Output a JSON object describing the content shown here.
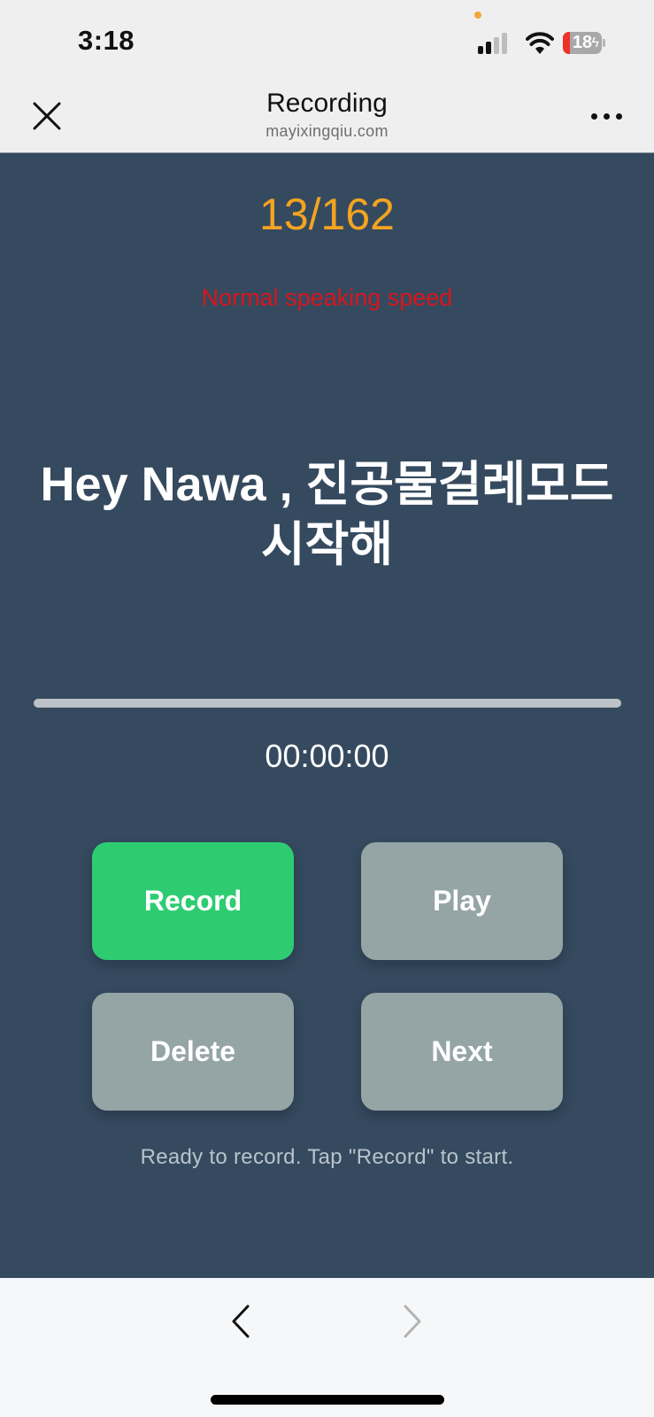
{
  "status_bar": {
    "time": "3:18",
    "battery_percent": "18",
    "battery_level": 0.18,
    "charging": true,
    "signal_bars_active": 2,
    "signal_bars_total": 4,
    "colors": {
      "mic_indicator": "#f4a43a",
      "battery_low": "#f0302a"
    }
  },
  "nav": {
    "title": "Recording",
    "subtitle": "mayixingqiu.com",
    "close_icon": "close-icon",
    "more_icon": "more-horizontal-icon"
  },
  "main": {
    "counter": "13/162",
    "current_index": 13,
    "total": 162,
    "speed_hint": "Normal speaking speed",
    "prompt_text": "Hey Nawa , 진공물걸레모드 시작해",
    "progress": 0,
    "timer": "00:00:00",
    "buttons": {
      "record": "Record",
      "play": "Play",
      "delete": "Delete",
      "next": "Next"
    },
    "status_message": "Ready to record. Tap \"Record\" to start.",
    "colors": {
      "background": "#354a5f",
      "counter": "#f3a420",
      "speed_hint": "#d7161d",
      "record_button": "#2ecc71",
      "secondary_button": "#95a5a6"
    }
  },
  "bottom_bar": {
    "back_icon": "chevron-left-icon",
    "forward_icon": "chevron-right-icon",
    "forward_enabled": false
  }
}
